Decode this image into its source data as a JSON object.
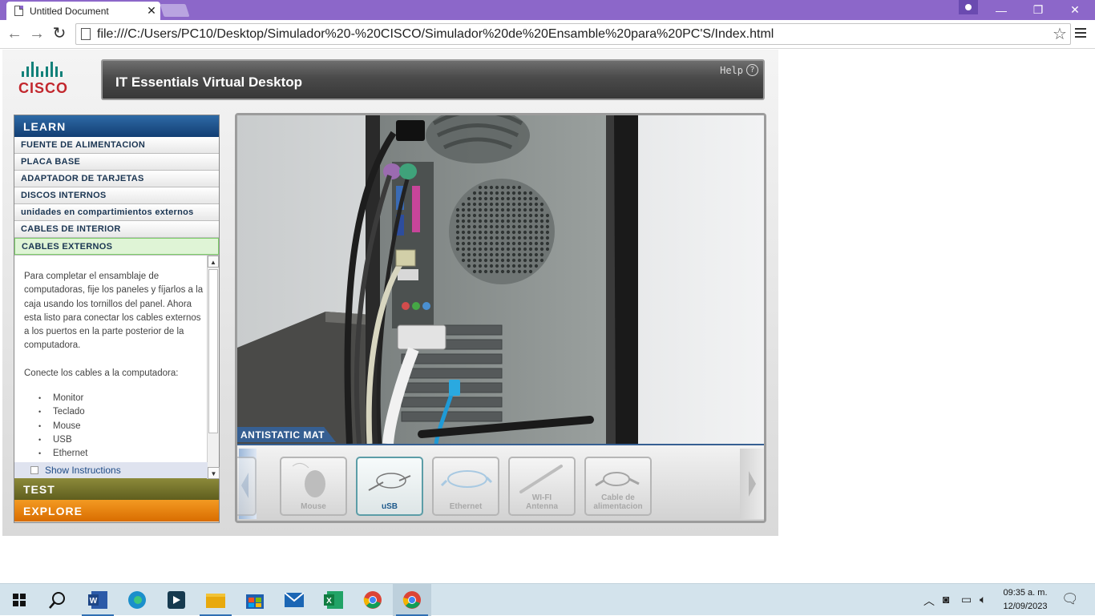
{
  "browser": {
    "tab_title": "Untitled Document",
    "url": "file:///C:/Users/PC10/Desktop/Simulador%20-%20CISCO/Simulador%20de%20Ensamble%20para%20PC'S/Index.html"
  },
  "app": {
    "logo_text": "CISCO",
    "title": "IT Essentials Virtual Desktop",
    "help_label": "Help",
    "help_icon": "?"
  },
  "nav": {
    "learn_label": "LEARN",
    "items": [
      {
        "label": "FUENTE DE ALIMENTACION"
      },
      {
        "label": "PLACA BASE"
      },
      {
        "label": "ADAPTADOR DE TARJETAS"
      },
      {
        "label": "DISCOS INTERNOS"
      },
      {
        "label": "unidades en compartimientos externos"
      },
      {
        "label": "CABLES DE INTERIOR"
      },
      {
        "label": "CABLES EXTERNOS",
        "selected": true
      }
    ],
    "test_label": "TEST",
    "explore_label": "EXPLORE"
  },
  "instructions": {
    "paragraph1": "Para completar el ensamblaje de computadoras, fije los paneles y fíjarlos a la caja usando los tornillos del panel. Ahora esta listo para conectar los cables externos a los puertos en la parte posterior de la computadora.",
    "paragraph2": "Conecte los cables a la computadora:",
    "bullets": [
      "Monitor",
      "Teclado",
      "Mouse",
      "USB",
      "Ethernet"
    ],
    "show_instructions": "Show Instructions"
  },
  "stage": {
    "mat_label": "ANTISTATIC MAT",
    "tray_items": [
      {
        "label": "Mouse",
        "active": false,
        "icon": "mouse-icon"
      },
      {
        "label": "uSB",
        "active": true,
        "icon": "usb-cable-icon"
      },
      {
        "label": "Ethernet",
        "active": false,
        "icon": "ethernet-cable-icon"
      },
      {
        "label": "WI-FI",
        "label2": "Antenna",
        "active": false,
        "icon": "wifi-antenna-icon"
      },
      {
        "label": "Cable de",
        "label2": "alimentacion",
        "active": false,
        "icon": "power-cable-icon"
      }
    ]
  },
  "taskbar": {
    "time": "09:35 a. m.",
    "date": "12/09/2023"
  },
  "colors": {
    "titlebar": "#8c67c9",
    "learn": "#1e4f88",
    "test": "#7a7830",
    "explore": "#e87f0d",
    "selected_item": "#dff4d6"
  }
}
